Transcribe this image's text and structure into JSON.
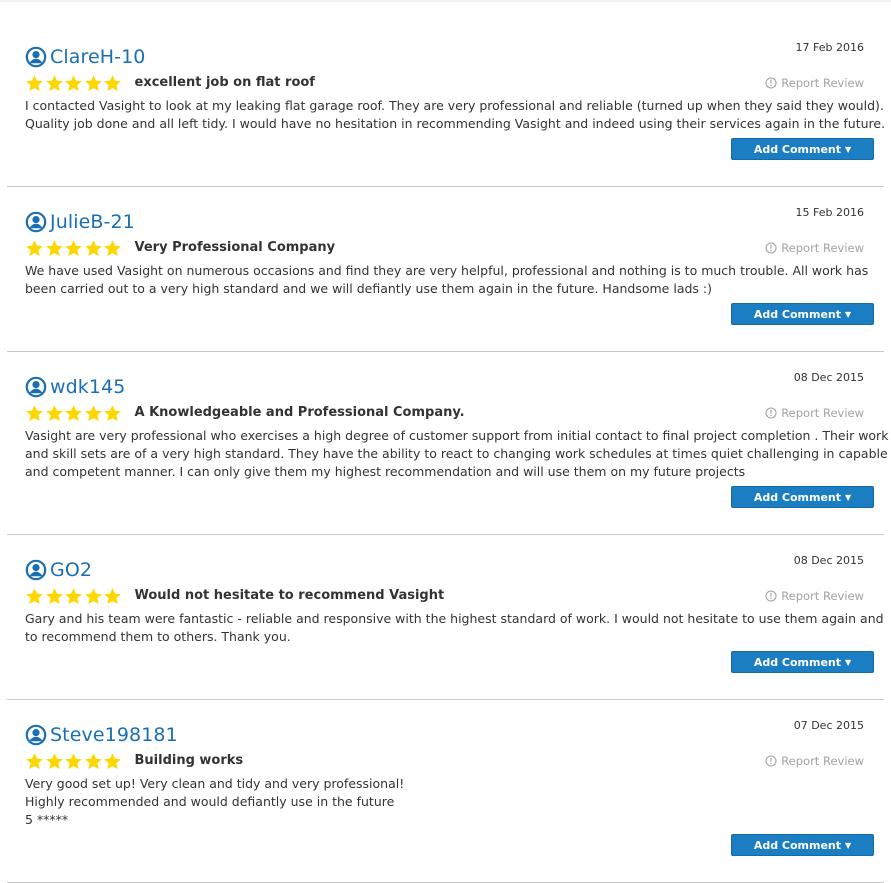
{
  "report_label": "Report Review",
  "add_comment_label": "Add Comment",
  "add_comment_caret": "▼",
  "star_color": "#ffd700",
  "accent_color": "#1a6fb3",
  "button_color": "#1b7ec2",
  "reviews": [
    {
      "user": "ClareH-10",
      "date": "17 Feb 2016",
      "rating": 5,
      "title": "excellent job on flat roof",
      "body_lines": [
        "I contacted Vasight to look at my leaking flat garage roof. They are very professional and reliable (turned up when they said they would).",
        "Quality job done and all left tidy. I would have no hesitation in recommending Vasight and indeed using their services again in the future."
      ]
    },
    {
      "user": "JulieB-21",
      "date": "15 Feb 2016",
      "rating": 5,
      "title": "Very Professional Company",
      "body_lines": [
        "We have used Vasight on numerous occasions and find they are very helpful, professional and nothing is to much trouble. All work has",
        "been carried out to a very high standard and we will defiantly use them again in the future. Handsome lads :)"
      ]
    },
    {
      "user": "wdk145",
      "date": "08 Dec 2015",
      "rating": 5,
      "title": "A Knowledgeable and Professional Company.",
      "body_lines": [
        "Vasight are very professional who exercises a high degree of customer support from initial contact to final project completion . Their work",
        "and skill sets are of a very high standard. They have the ability to react to changing work schedules at times quiet challenging in capable",
        "and competent manner. I can only give them my highest recommendation and will use them on my future projects"
      ]
    },
    {
      "user": "GO2",
      "date": "08 Dec 2015",
      "rating": 5,
      "title": "Would not hesitate to recommend Vasight",
      "body_lines": [
        "Gary and his team were fantastic - reliable and responsive with the highest standard of work. I would not hesitate to use them again and",
        "to recommend them to others. Thank you."
      ]
    },
    {
      "user": "Steve198181",
      "date": "07 Dec 2015",
      "rating": 5,
      "title": "Building works",
      "body_lines": [
        "Very good set up! Very clean and tidy and very professional!",
        "Highly recommended and would defiantly use in the future",
        "5 *****"
      ]
    }
  ]
}
